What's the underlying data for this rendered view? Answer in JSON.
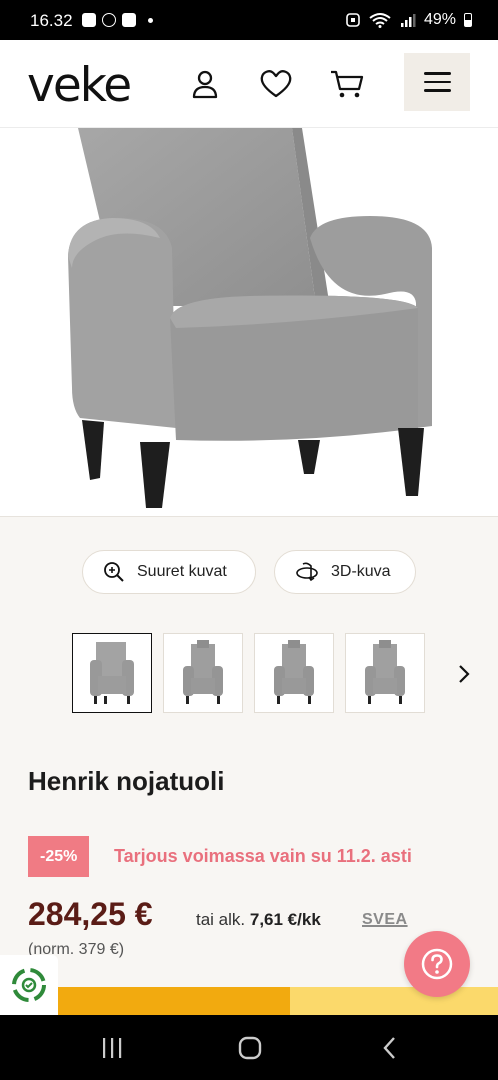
{
  "status_bar": {
    "time": "16.32",
    "battery": "49%",
    "icons": [
      "gallery-icon",
      "speedometer-icon",
      "checkbox-icon",
      "dot-icon",
      "alarm-icon",
      "wifi-icon",
      "signal-icon",
      "battery-icon"
    ]
  },
  "header": {
    "logo": "veke",
    "icons": [
      "user-icon",
      "heart-icon",
      "cart-icon",
      "hamburger-menu-icon"
    ]
  },
  "gallery": {
    "large_images_label": "Suuret kuvat",
    "view_3d_label": "3D-kuva",
    "thumbnail_count": 4,
    "selected_thumbnail": 1
  },
  "product": {
    "name": "Henrik nojatuoli",
    "discount_badge": "-25%",
    "offer_text": "Tarjous voimassa vain su 11.2. asti",
    "price": "284,25 €",
    "monthly_prefix": "tai alk.",
    "monthly_amount": "7,61 €/kk",
    "financing_brand": "SVEA",
    "normal_price": "(norm. 379 €)"
  },
  "colors": {
    "accent_pink": "#f07b84",
    "price_brown": "#5a1c16",
    "banner_orange": "#f2aa0f",
    "banner_yellow": "#fbd96b",
    "menu_bg": "#f1ede7",
    "eco_green": "#2f8a3a"
  }
}
